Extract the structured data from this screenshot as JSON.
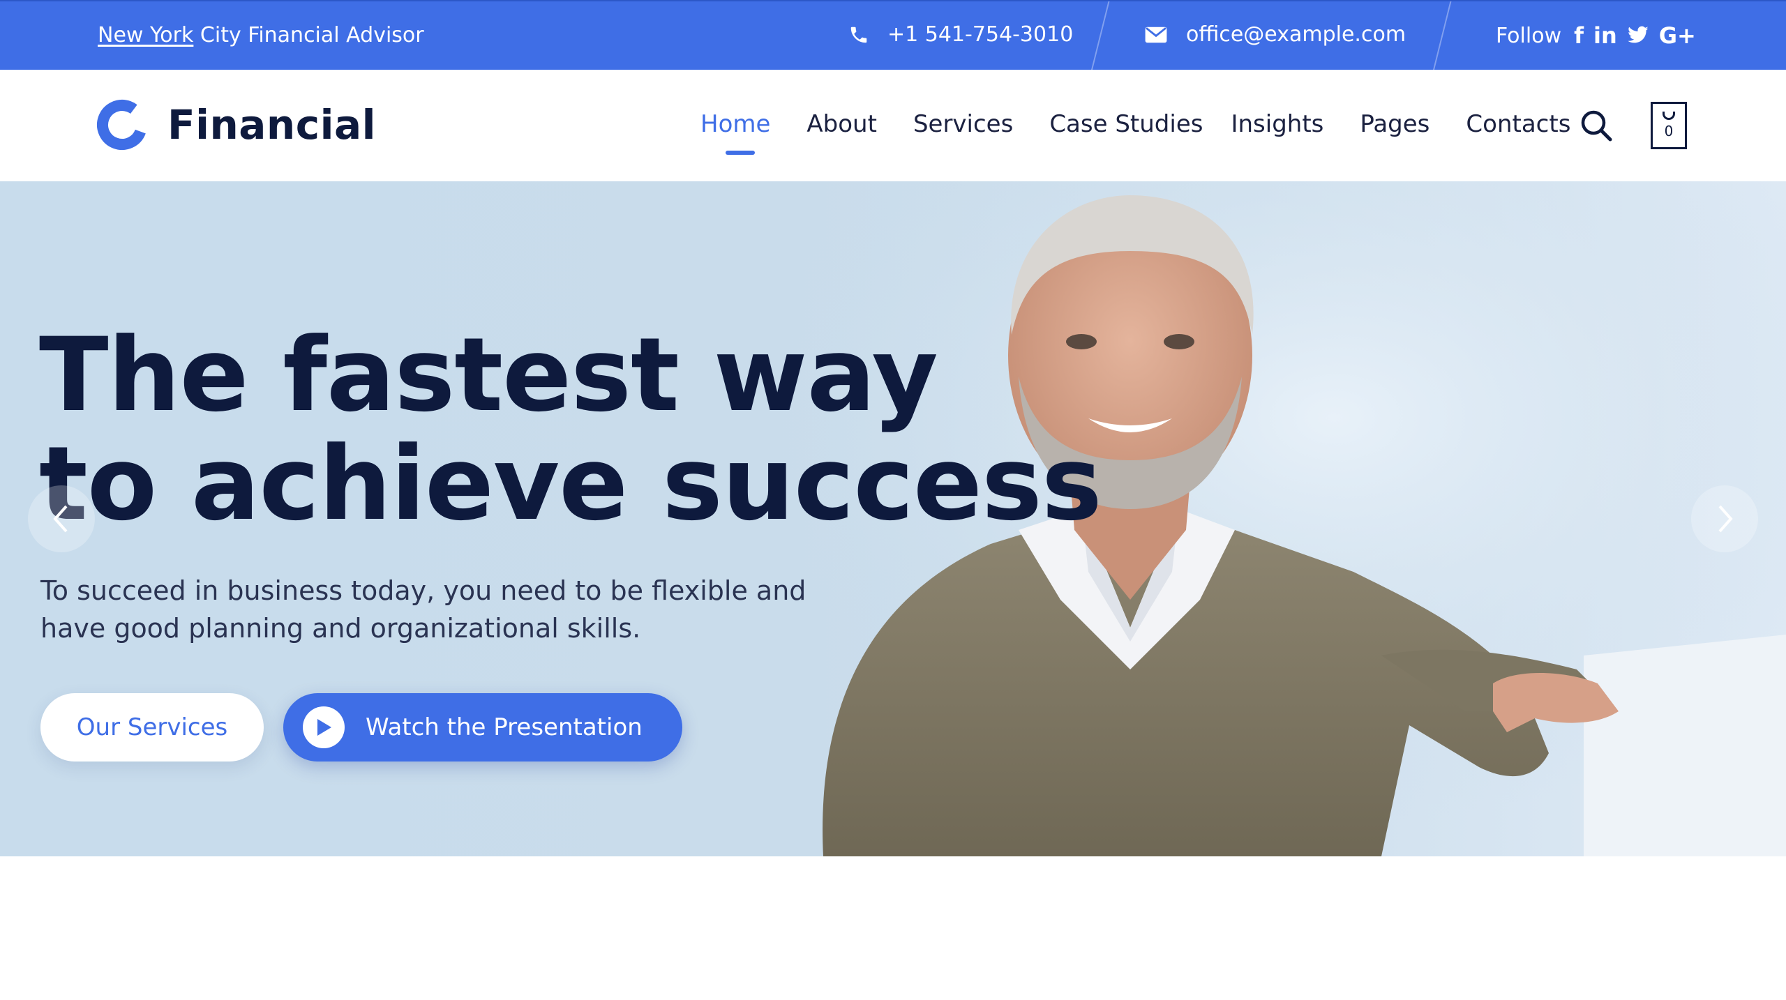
{
  "topbar": {
    "location": "New York",
    "tagline_rest": " City Financial Advisor",
    "phone": "+1 541-754-3010",
    "email": "office@example.com",
    "follow_label": "Follow",
    "social_icons": [
      "facebook-icon",
      "linkedin-icon",
      "twitter-icon",
      "google-plus-icon"
    ]
  },
  "header": {
    "brand": "Financial",
    "nav": [
      {
        "label": "Home",
        "active": true
      },
      {
        "label": "About",
        "active": false
      },
      {
        "label": "Services",
        "active": false
      },
      {
        "label": "Case Studies",
        "active": false
      },
      {
        "label": "Insights",
        "active": false
      },
      {
        "label": "Pages",
        "active": false
      },
      {
        "label": "Contacts",
        "active": false
      }
    ],
    "cart_count": "0"
  },
  "hero": {
    "title_line1": "The fastest way",
    "title_line2": "to achieve success",
    "subtitle": "To succeed in business today, you need to be flexible and have good planning and organizational skills.",
    "primary_button": "Our Services",
    "secondary_button": "Watch the Presentation"
  },
  "colors": {
    "accent": "#3f6ee6",
    "heading": "#0e1a3d",
    "hero_bg": "#c9dceb"
  }
}
